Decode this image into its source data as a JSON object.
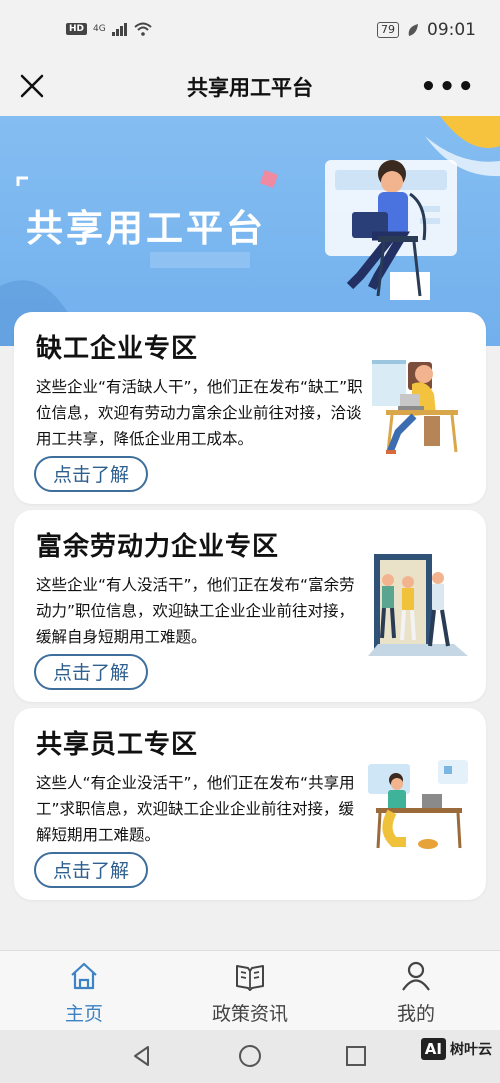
{
  "status_bar": {
    "network": "HD",
    "signal": "4G",
    "battery": "79",
    "time": "09:01"
  },
  "nav": {
    "title": "共享用工平台"
  },
  "banner": {
    "title": "共享用工平台"
  },
  "cards": [
    {
      "title": "缺工企业专区",
      "desc": "这些企业“有活缺人干”，他们正在发布“缺工”职位信息，欢迎有劳动力富余企业前往对接，洽谈用工共享，降低企业用工成本。",
      "button": "点击了解"
    },
    {
      "title": "富余劳动力企业专区",
      "desc": "这些企业“有人没活干”，他们正在发布“富余劳动力”职位信息，欢迎缺工企业企业前往对接，缓解自身短期用工难题。",
      "button": "点击了解"
    },
    {
      "title": "共享员工专区",
      "desc": "这些人“有企业没活干”，他们正在发布“共享用工”求职信息，欢迎缺工企业企业前往对接，缓解短期用工难题。",
      "button": "点击了解"
    }
  ],
  "tabs": [
    {
      "label": "主页",
      "icon": "home-icon",
      "active": true
    },
    {
      "label": "政策资讯",
      "icon": "book-icon",
      "active": false
    },
    {
      "label": "我的",
      "icon": "user-icon",
      "active": false
    }
  ],
  "colors": {
    "accent": "#3c82c4",
    "banner": "#7bb7f0",
    "button_border": "#3d6e9c"
  },
  "watermark": {
    "badge": "AI",
    "text": "树叶云"
  }
}
